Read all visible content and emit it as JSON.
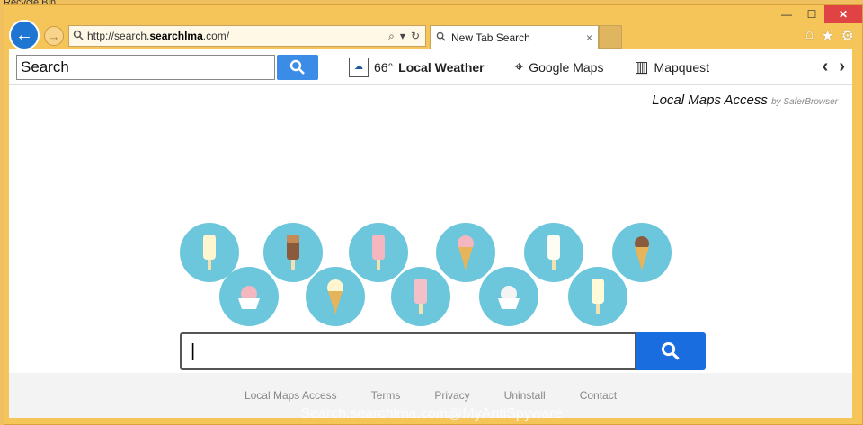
{
  "desktop": {
    "recycle_label": "Recycle Bin"
  },
  "window": {
    "controls": {
      "minimize": "—",
      "maximize": "☐",
      "close": "✕"
    }
  },
  "nav": {
    "back_icon": "←",
    "forward_icon": "→",
    "address": {
      "url_prefix": "http://search.",
      "url_bold": "searchlma",
      "url_suffix": ".com/"
    },
    "address_icons": {
      "search": "⌕",
      "refresh": "↻"
    }
  },
  "tab": {
    "label": "New Tab Search",
    "close": "×"
  },
  "topright": {
    "home": "⌂",
    "favorites": "★",
    "settings": "⚙"
  },
  "toolbar": {
    "search_value": "Search",
    "weather_temp": "66°",
    "weather_label": "Local Weather",
    "google_maps": "Google Maps",
    "mapquest": "Mapquest",
    "prev": "‹",
    "next": "›"
  },
  "brand": {
    "name": "Local Maps Access",
    "by": "by SaferBrowser"
  },
  "footer": {
    "links": [
      "Local Maps Access",
      "Terms",
      "Privacy",
      "Uninstall",
      "Contact"
    ]
  },
  "watermark": "Search.searchlma.com@MyAntiSpyware",
  "colors": {
    "accent": "#1a6ddf",
    "frame": "#f5c55a",
    "bubble": "#6cc6dc"
  }
}
